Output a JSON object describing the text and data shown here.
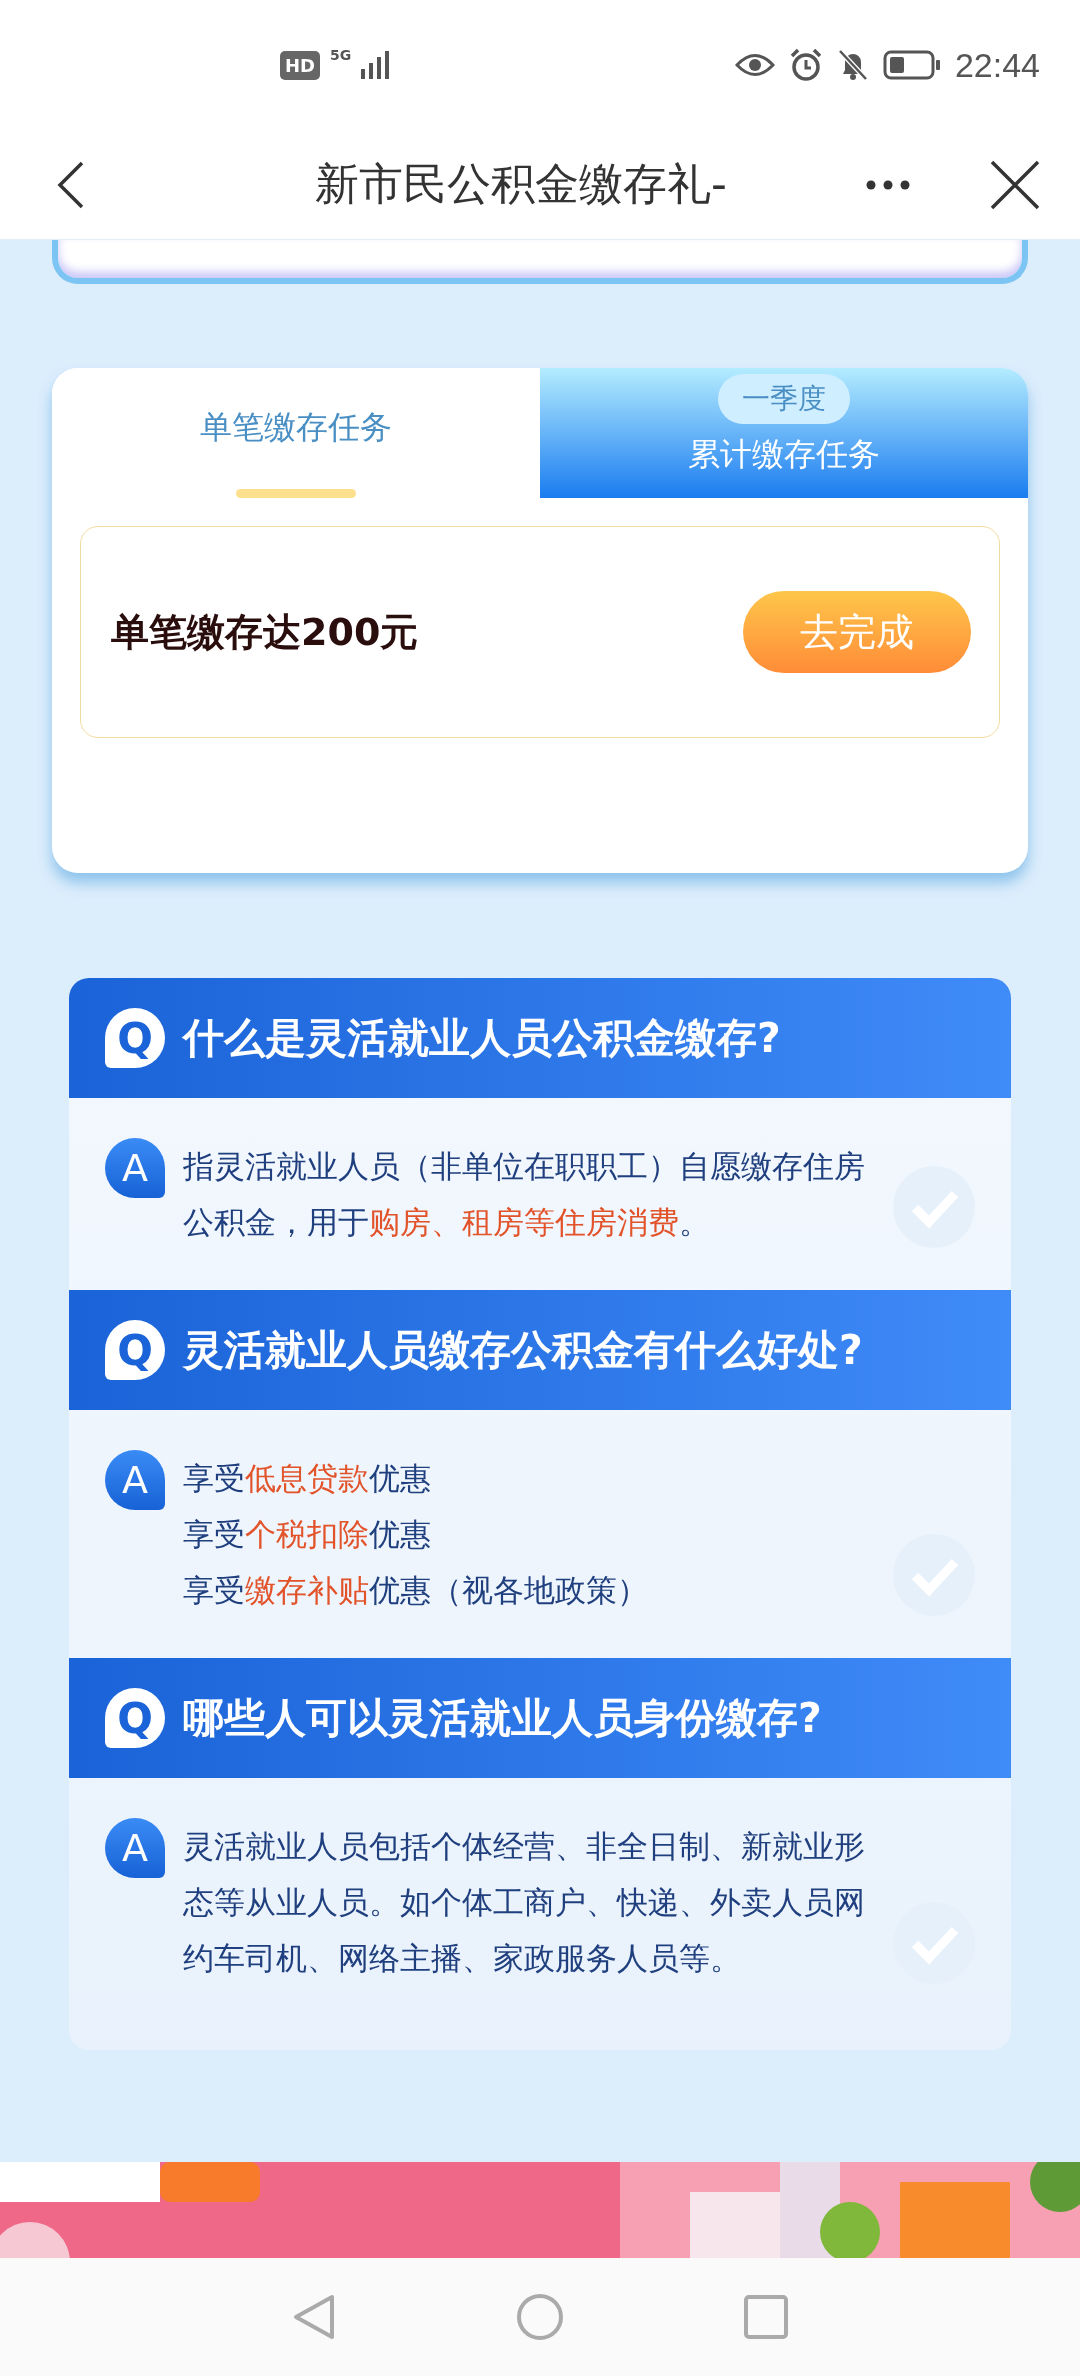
{
  "status_bar": {
    "hd": "HD",
    "network": "5G",
    "time": "22:44"
  },
  "nav": {
    "title": "新市民公积金缴存礼-"
  },
  "tabs": [
    {
      "label": "单笔缴存任务",
      "selected": true
    },
    {
      "label": "累计缴存任务",
      "badge": "一季度",
      "selected": false
    }
  ],
  "task": {
    "text": "单笔缴存达200元",
    "button": "去完成"
  },
  "faq": [
    {
      "q": "Q",
      "question": "什么是灵活就业人员公积金缴存?",
      "a": "A",
      "paragraphs": [
        [
          {
            "text": "指灵活就业人员（非单位在职职工）自愿缴存住房公积金，用于",
            "highlight": false
          },
          {
            "text": "购房、租房等住房消费",
            "highlight": true
          },
          {
            "text": "。",
            "highlight": false
          }
        ]
      ]
    },
    {
      "q": "Q",
      "question": "灵活就业人员缴存公积金有什么好处?",
      "a": "A",
      "paragraphs": [
        [
          {
            "text": "享受",
            "highlight": false
          },
          {
            "text": "低息贷款",
            "highlight": true
          },
          {
            "text": "优惠",
            "highlight": false
          }
        ],
        [
          {
            "text": "享受",
            "highlight": false
          },
          {
            "text": "个税扣除",
            "highlight": true
          },
          {
            "text": "优惠",
            "highlight": false
          }
        ],
        [
          {
            "text": "享受",
            "highlight": false
          },
          {
            "text": "缴存补贴",
            "highlight": true
          },
          {
            "text": "优惠（视各地政策）",
            "highlight": false
          }
        ]
      ]
    },
    {
      "q": "Q",
      "question": "哪些人可以灵活就业人员身份缴存?",
      "a": "A",
      "paragraphs": [
        [
          {
            "text": "灵活就业人员包括个体经营、非全日制、新就业形态等从业人员。如个体工商户、快递、外卖人员网约车司机、网络主播、家政服务人员等。",
            "highlight": false
          }
        ]
      ]
    }
  ]
}
